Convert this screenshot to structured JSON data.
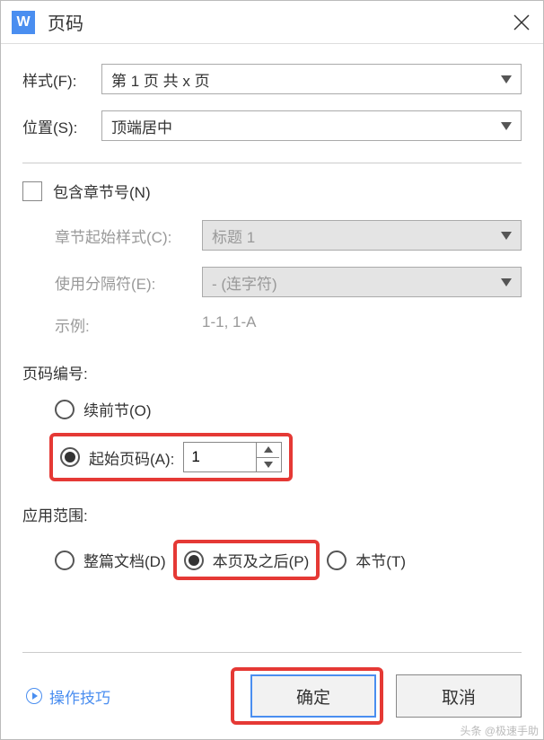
{
  "title": "页码",
  "app_icon_letter": "W",
  "style_row": {
    "label": "样式(F):",
    "value": "第 1 页 共 x 页"
  },
  "position_row": {
    "label": "位置(S):",
    "value": "顶端居中"
  },
  "include_chapter": {
    "label": "包含章节号(N)",
    "checked": false
  },
  "chapter_style": {
    "label": "章节起始样式(C):",
    "value": "标题 1"
  },
  "separator": {
    "label": "使用分隔符(E):",
    "value": "-    (连字符)"
  },
  "example": {
    "label": "示例:",
    "value": "1-1, 1-A"
  },
  "numbering": {
    "section_label": "页码编号:",
    "continue_label": "续前节(O)",
    "start_label": "起始页码(A):",
    "start_value": "1",
    "selected": "start"
  },
  "scope": {
    "section_label": "应用范围:",
    "whole_doc": "整篇文档(D)",
    "this_page_after": "本页及之后(P)",
    "this_section": "本节(T)",
    "selected": "this_page_after"
  },
  "footer": {
    "tip": "操作技巧",
    "ok": "确定",
    "cancel": "取消"
  },
  "watermark": "头条 @极速手助"
}
